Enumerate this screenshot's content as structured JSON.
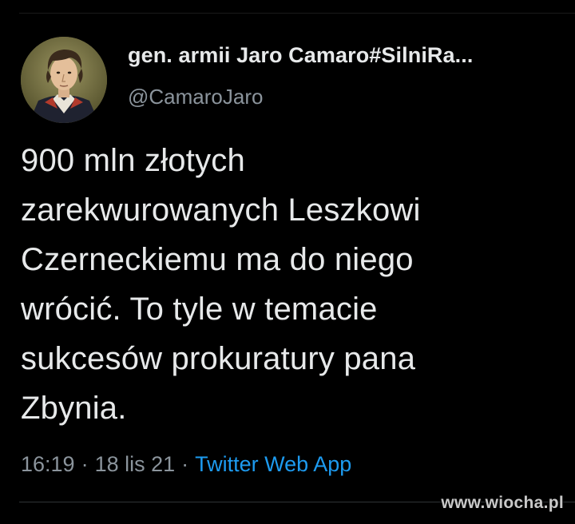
{
  "tweet": {
    "author": {
      "display_name": "gen. armii Jaro Camaro#SilniRa...",
      "handle": "@CamaroJaro",
      "avatar_icon": "portrait-avatar"
    },
    "text": "900 mln złotych\nzarekwurowanych Leszkowi\nCzerneckiemu ma do niego\nwrócić. To tyle w temacie\nsukcesów prokuratury pana\nZbynia.",
    "time": "16:19",
    "date": "18 lis 21",
    "separator": "·",
    "source": "Twitter Web App"
  },
  "watermark": "www.wiocha.pl",
  "colors": {
    "background": "#000000",
    "text": "#e7e9ea",
    "muted": "#8b949c",
    "link": "#1d9bf0"
  }
}
